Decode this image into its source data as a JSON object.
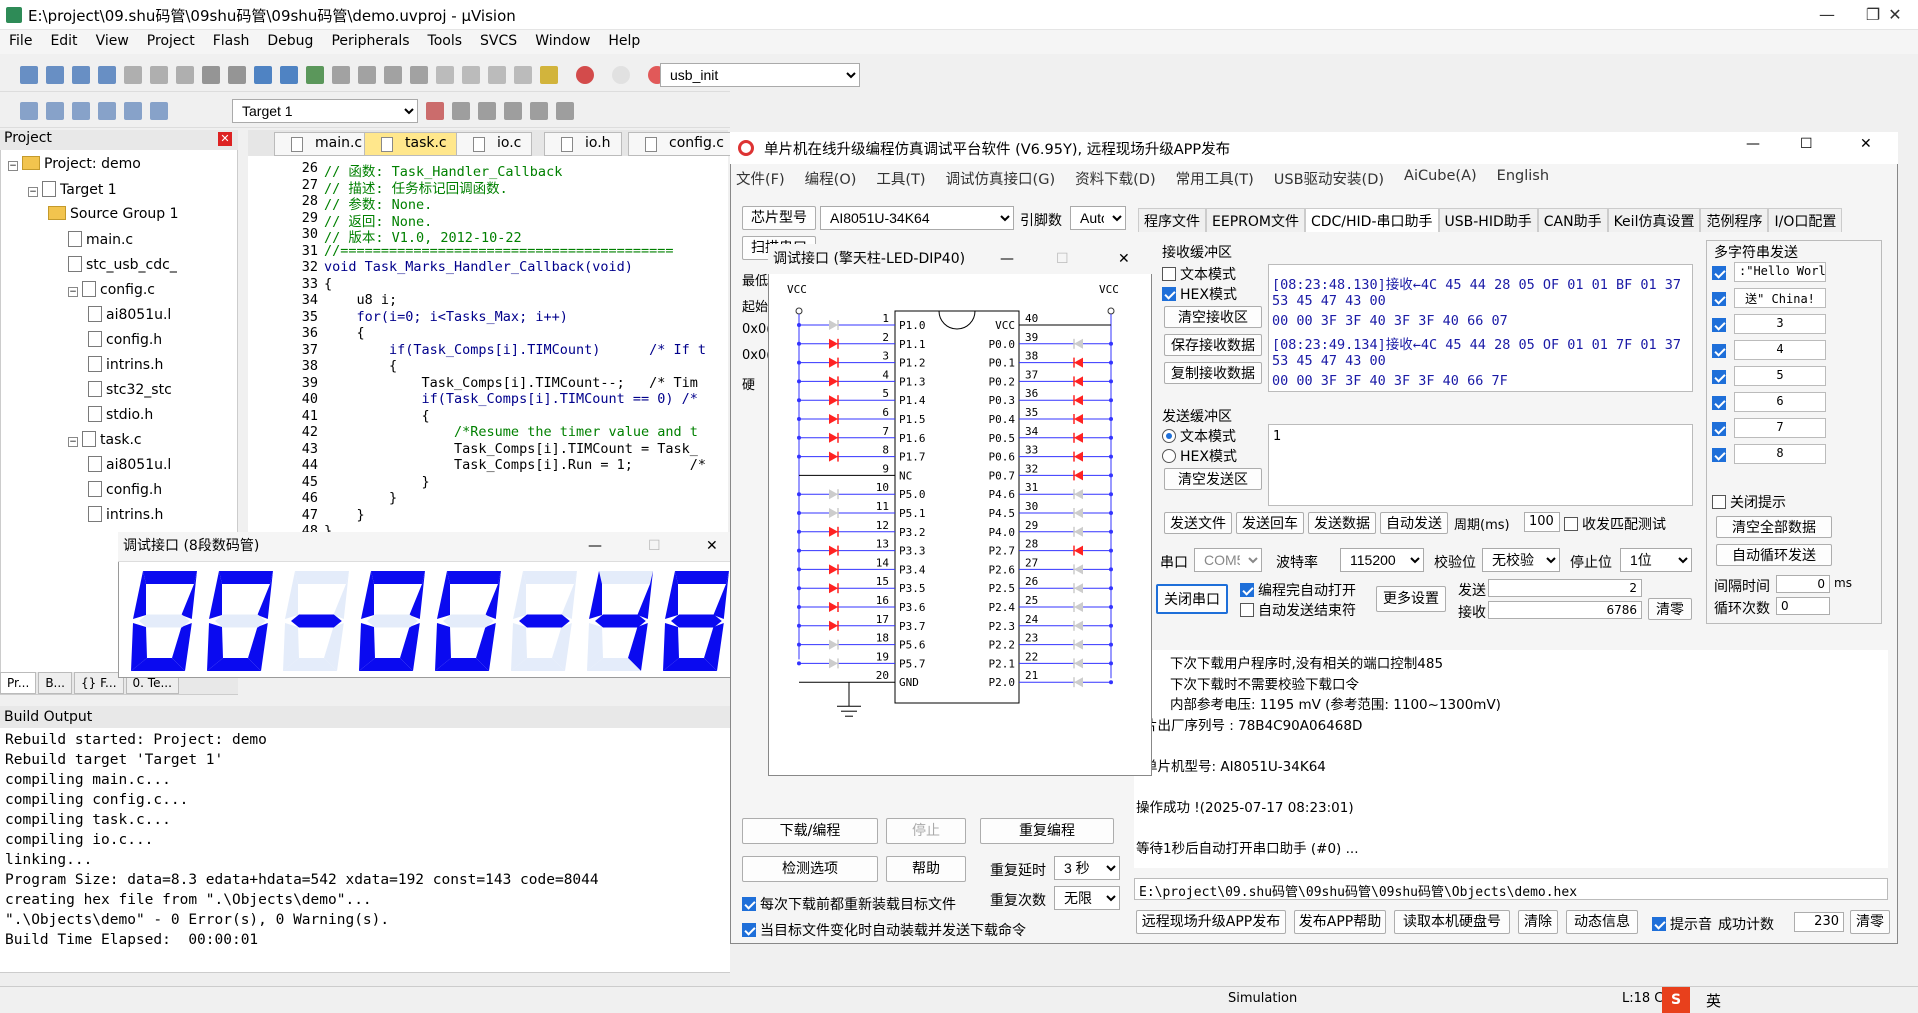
{
  "uvision": {
    "title": "E:\\project\\09.shu码管\\09shu码管\\09shu码管\\demo.uvproj - µVision",
    "menu": [
      "File",
      "Edit",
      "View",
      "Project",
      "Flash",
      "Debug",
      "Peripherals",
      "Tools",
      "SVCS",
      "Window",
      "Help"
    ],
    "toolbar_func": "usb_init",
    "target": "Target 1",
    "project_pane_title": "Project",
    "tree": [
      {
        "label": "Project: demo",
        "level": 0
      },
      {
        "label": "Target 1",
        "level": 1
      },
      {
        "label": "Source Group 1",
        "level": 2
      },
      {
        "label": "main.c",
        "level": 3
      },
      {
        "label": "stc_usb_cdc_",
        "level": 3
      },
      {
        "label": "config.c",
        "level": 3
      },
      {
        "label": "ai8051u.l",
        "level": 4
      },
      {
        "label": "config.h",
        "level": 4
      },
      {
        "label": "intrins.h",
        "level": 4
      },
      {
        "label": "stc32_stc",
        "level": 4
      },
      {
        "label": "stdio.h",
        "level": 4
      },
      {
        "label": "task.c",
        "level": 3
      },
      {
        "label": "ai8051u.l",
        "level": 4
      },
      {
        "label": "config.h",
        "level": 4
      },
      {
        "label": "intrins.h",
        "level": 4
      }
    ],
    "bottom_tabs": [
      "Pr...",
      "B...",
      "{} F...",
      "0. Te..."
    ],
    "tabs": [
      {
        "label": "main.c",
        "active": false
      },
      {
        "label": "task.c",
        "active": true
      },
      {
        "label": "io.c",
        "active": false
      },
      {
        "label": "io.h",
        "active": false
      },
      {
        "label": "config.c",
        "active": false
      }
    ],
    "code": [
      {
        "n": "26",
        "t": "// 函数: Task_Handler_Callback",
        "c": "#008000"
      },
      {
        "n": "27",
        "t": "// 描述: 任务标记回调函数.",
        "c": "#008000"
      },
      {
        "n": "28",
        "t": "// 参数: None.",
        "c": "#008000"
      },
      {
        "n": "29",
        "t": "// 返回: None.",
        "c": "#008000"
      },
      {
        "n": "30",
        "t": "// 版本: V1.0, 2012-10-22",
        "c": "#008000"
      },
      {
        "n": "31",
        "t": "//=========================================",
        "c": "#008000"
      },
      {
        "n": "32",
        "t": "void Task_Marks_Handler_Callback(void)",
        "c": "#00008b"
      },
      {
        "n": "33",
        "t": "{",
        "c": "#000"
      },
      {
        "n": "34",
        "t": "    u8 i;",
        "c": "#000"
      },
      {
        "n": "35",
        "t": "    for(i=0; i<Tasks_Max; i++)",
        "c": "#00008b"
      },
      {
        "n": "36",
        "t": "    {",
        "c": "#000"
      },
      {
        "n": "37",
        "t": "        if(Task_Comps[i].TIMCount)      /* If t",
        "c": "#00008b"
      },
      {
        "n": "38",
        "t": "        {",
        "c": "#000"
      },
      {
        "n": "39",
        "t": "            Task_Comps[i].TIMCount--;   /* Tim",
        "c": "#000"
      },
      {
        "n": "40",
        "t": "            if(Task_Comps[i].TIMCount == 0) /*",
        "c": "#00008b"
      },
      {
        "n": "41",
        "t": "            {",
        "c": "#000"
      },
      {
        "n": "42",
        "t": "                /*Resume the timer value and t",
        "c": "#008000"
      },
      {
        "n": "43",
        "t": "                Task_Comps[i].TIMCount = Task_",
        "c": "#000"
      },
      {
        "n": "44",
        "t": "                Task_Comps[i].Run = 1;       /*",
        "c": "#000"
      },
      {
        "n": "45",
        "t": "            }",
        "c": "#000"
      },
      {
        "n": "46",
        "t": "        }",
        "c": "#000"
      },
      {
        "n": "47",
        "t": "    }",
        "c": "#000"
      },
      {
        "n": "48",
        "t": "}",
        "c": "#000"
      }
    ],
    "build_title": "Build Output",
    "build": [
      "Rebuild started: Project: demo",
      "Rebuild target 'Target 1'",
      "compiling main.c...",
      "compiling config.c...",
      "compiling task.c...",
      "compiling io.c...",
      "linking...",
      "Program Size: data=8.3 edata+hdata=542 xdata=192 const=143 code=8044",
      "creating hex file from \".\\Objects\\demo\"...",
      "\".\\Objects\\demo\" - 0 Error(s), 0 Warning(s).",
      "Build Time Elapsed:  00:00:01"
    ],
    "status_sim": "Simulation",
    "status_pos": "L:18 C"
  },
  "seg": {
    "title": "调试接口 (8段数码管)",
    "digits": "00-00-48",
    "color": "#0a0af0",
    "ghost": "#e4ecfa"
  },
  "stc": {
    "title": "单片机在线升级编程仿真调试平台软件 (V6.95Y), 远程现场升级APP发布",
    "menu": [
      "文件(F)",
      "编程(O)",
      "工具(T)",
      "调试仿真接口(G)",
      "资料下载(D)",
      "常用工具(T)",
      "USB驱动安装(D)",
      "AiCube(A)",
      "English"
    ],
    "chip_label": "芯片型号",
    "chip": "AI8051U-34K64",
    "pins_label": "引脚数",
    "pins": "Auto",
    "scan_label": "扫描串口",
    "left_labels": [
      "最低",
      "起始",
      "0x0(",
      "0x0(",
      "硬"
    ],
    "tabs": [
      "程序文件",
      "EEPROM文件",
      "CDC/HID-串口助手",
      "USB-HID助手",
      "CAN助手",
      "Keil仿真设置",
      "范例程序",
      "I/O口配置"
    ],
    "active_tab": "CDC/HID-串口助手",
    "rx_title": "接收缓冲区",
    "rx_text_mode": "文本模式",
    "rx_hex_mode": "HEX模式",
    "rx_clear": "清空接收区",
    "rx_save": "保存接收数据",
    "rx_copy": "复制接收数据",
    "rx_lines": [
      "[08:23:48.130]接收←4C 45 44 28 05 OF 01 01 BF 01 37",
      "53 45 47 43 00",
      "00 00 3F 3F 40 3F 3F 40 66 07",
      "[08:23:49.134]接收←4C 45 44 28 05 OF 01 01 7F 01 37",
      "53 45 47 43 00",
      "00 00 3F 3F 40 3F 3F 40 66 7F"
    ],
    "tx_title": "发送缓冲区",
    "tx_text_mode": "文本模式",
    "tx_hex_mode": "HEX模式",
    "tx_clear": "清空发送区",
    "tx_content": "1",
    "send_file": "发送文件",
    "send_cr": "发送回车",
    "send_data": "发送数据",
    "auto_send": "自动发送",
    "period_label": "周期(ms)",
    "period": "100",
    "match_label": "收发匹配测试",
    "port_label": "串口",
    "port": "COM5",
    "baud_label": "波特率",
    "baud": "115200",
    "parity_label": "校验位",
    "parity": "无校验",
    "stop_label": "停止位",
    "stop": "1位",
    "close_port": "关闭串口",
    "auto_open": "编程完自动打开",
    "auto_end": "自动发送结束符",
    "more_settings": "更多设置",
    "send_label": "发送",
    "send_count": "2",
    "recv_label": "接收",
    "recv_count": "6786",
    "clear_count": "清零",
    "multi_title": "多字符串发送",
    "multi": [
      ":\"Hello Worl",
      "送\" China!",
      "3",
      "4",
      "5",
      "6",
      "7",
      "8"
    ],
    "close_tip": "关闭提示",
    "clear_all": "清空全部数据",
    "auto_loop": "自动循环发送",
    "interval_label": "间隔时间",
    "interval": "0",
    "interval_unit": "ms",
    "loop_label": "循环次数",
    "loop": "0",
    "log": [
      "下次下载用户程序时,没有相关的端口控制485",
      "下次下载时不需要校验下载口令",
      "内部参考电压: 1195 mV (参考范围: 1100~1300mV)",
      "片出厂序列号 : 78B4C90A06468D",
      "",
      "单片机型号: AI8051U-34K64",
      "",
      "操作成功 !(2025-07-17 08:23:01)",
      "",
      "等待1秒后自动打开串口助手 (#0) ..."
    ],
    "hex_path": "E:\\project\\09.shu码管\\09shu码管\\09shu码管\\Objects\\demo.hex",
    "download": "下载/编程",
    "stop_btn": "停止",
    "reprogram": "重复编程",
    "check_opts": "检测选项",
    "help": "帮助",
    "repeat_delay_label": "重复延时",
    "repeat_delay": "3 秒",
    "repeat_count_label": "重复次数",
    "repeat_count": "无限",
    "reload_each": "每次下载前都重新装载目标文件",
    "auto_load": "当目标文件变化时自动装载并发送下载命令",
    "remote_app": "远程现场升级APP发布",
    "app_help": "发布APP帮助",
    "read_disk": "读取本机硬盘号",
    "clear": "清除",
    "dyn_info": "动态信息",
    "beep": "提示音",
    "success_label": "成功计数",
    "success": "230",
    "clear2": "清零"
  },
  "chip": {
    "title": "调试接口 (擎天柱-LED-DIP40)",
    "vcc": "VCC",
    "left_pins": [
      {
        "n": "1",
        "name": "P1.0",
        "led": "grey"
      },
      {
        "n": "2",
        "name": "P1.1",
        "led": "red"
      },
      {
        "n": "3",
        "name": "P1.2",
        "led": "red"
      },
      {
        "n": "4",
        "name": "P1.3",
        "led": "red"
      },
      {
        "n": "5",
        "name": "P1.4",
        "led": "red"
      },
      {
        "n": "6",
        "name": "P1.5",
        "led": "red"
      },
      {
        "n": "7",
        "name": "P1.6",
        "led": "red"
      },
      {
        "n": "8",
        "name": "P1.7",
        "led": "red"
      },
      {
        "n": "9",
        "name": "NC",
        "led": "none"
      },
      {
        "n": "10",
        "name": "P5.0",
        "led": "grey"
      },
      {
        "n": "11",
        "name": "P5.1",
        "led": "grey"
      },
      {
        "n": "12",
        "name": "P3.2",
        "led": "red"
      },
      {
        "n": "13",
        "name": "P3.3",
        "led": "red"
      },
      {
        "n": "14",
        "name": "P3.4",
        "led": "red"
      },
      {
        "n": "15",
        "name": "P3.5",
        "led": "red"
      },
      {
        "n": "16",
        "name": "P3.6",
        "led": "red"
      },
      {
        "n": "17",
        "name": "P3.7",
        "led": "red"
      },
      {
        "n": "18",
        "name": "P5.6",
        "led": "grey"
      },
      {
        "n": "19",
        "name": "P5.7",
        "led": "grey"
      },
      {
        "n": "20",
        "name": "GND",
        "led": "none"
      }
    ],
    "right_pins": [
      {
        "n": "40",
        "name": "VCC",
        "led": "none"
      },
      {
        "n": "39",
        "name": "P0.0",
        "led": "grey"
      },
      {
        "n": "38",
        "name": "P0.1",
        "led": "red"
      },
      {
        "n": "37",
        "name": "P0.2",
        "led": "red"
      },
      {
        "n": "36",
        "name": "P0.3",
        "led": "red"
      },
      {
        "n": "35",
        "name": "P0.4",
        "led": "red"
      },
      {
        "n": "34",
        "name": "P0.5",
        "led": "red"
      },
      {
        "n": "33",
        "name": "P0.6",
        "led": "red"
      },
      {
        "n": "32",
        "name": "P0.7",
        "led": "red"
      },
      {
        "n": "31",
        "name": "P4.6",
        "led": "grey"
      },
      {
        "n": "30",
        "name": "P4.5",
        "led": "grey"
      },
      {
        "n": "29",
        "name": "P4.0",
        "led": "grey"
      },
      {
        "n": "28",
        "name": "P2.7",
        "led": "red"
      },
      {
        "n": "27",
        "name": "P2.6",
        "led": "grey"
      },
      {
        "n": "26",
        "name": "P2.5",
        "led": "grey"
      },
      {
        "n": "25",
        "name": "P2.4",
        "led": "grey"
      },
      {
        "n": "24",
        "name": "P2.3",
        "led": "grey"
      },
      {
        "n": "23",
        "name": "P2.2",
        "led": "grey"
      },
      {
        "n": "22",
        "name": "P2.1",
        "led": "grey"
      },
      {
        "n": "21",
        "name": "P2.0",
        "led": "grey"
      }
    ]
  },
  "taskbar": {
    "ime": "英"
  }
}
